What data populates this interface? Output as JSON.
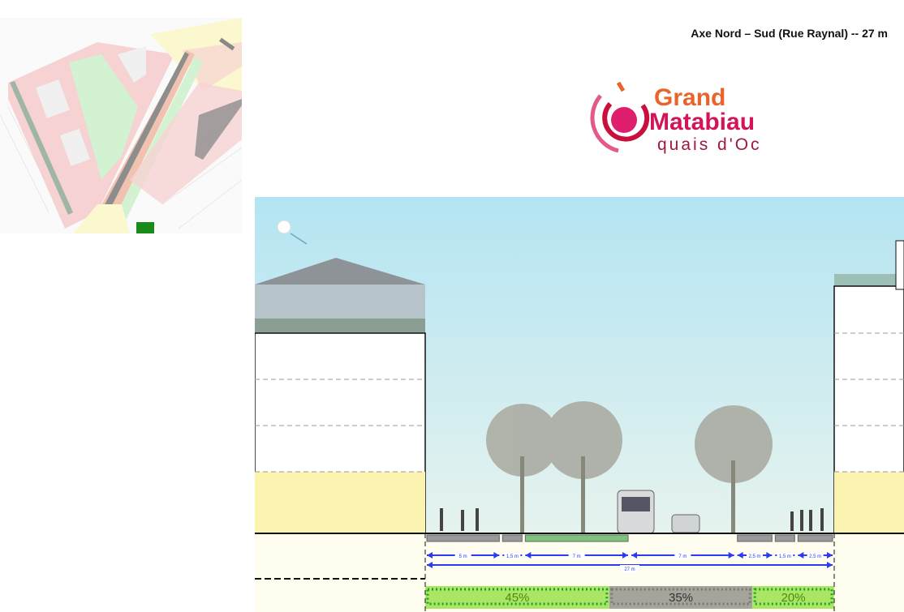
{
  "title": "Axe Nord – Sud (Rue Raynal) -- 27 m",
  "logo": {
    "line1": "Grand",
    "line2": "Matabiau",
    "line3": "quais d'Oc",
    "colors": {
      "orange": "#e8642a",
      "magenta": "#d4145a",
      "dark_red": "#a0183c"
    }
  },
  "section": {
    "total_label": "27 m",
    "segments": [
      {
        "label": "5 m",
        "type": "sidewalk"
      },
      {
        "label": "1,5 m",
        "type": "sidewalk"
      },
      {
        "label": "7 m",
        "type": "planted"
      },
      {
        "label": "7 m",
        "type": "roadway"
      },
      {
        "label": "2,5 m",
        "type": "sidewalk"
      },
      {
        "label": "1,5 m",
        "type": "sidewalk"
      },
      {
        "label": "2,5 m",
        "type": "sidewalk"
      }
    ],
    "shares": [
      {
        "label": "45%",
        "type": "green"
      },
      {
        "label": "35%",
        "type": "gray"
      },
      {
        "label": "20%",
        "type": "green"
      }
    ],
    "colors": {
      "sky": "#bfe6f2",
      "arrow": "#2b3cf0",
      "green_share": "#9be24a",
      "gray_share": "#9a9a90",
      "facade_yellow": "#fbf4b0"
    }
  }
}
